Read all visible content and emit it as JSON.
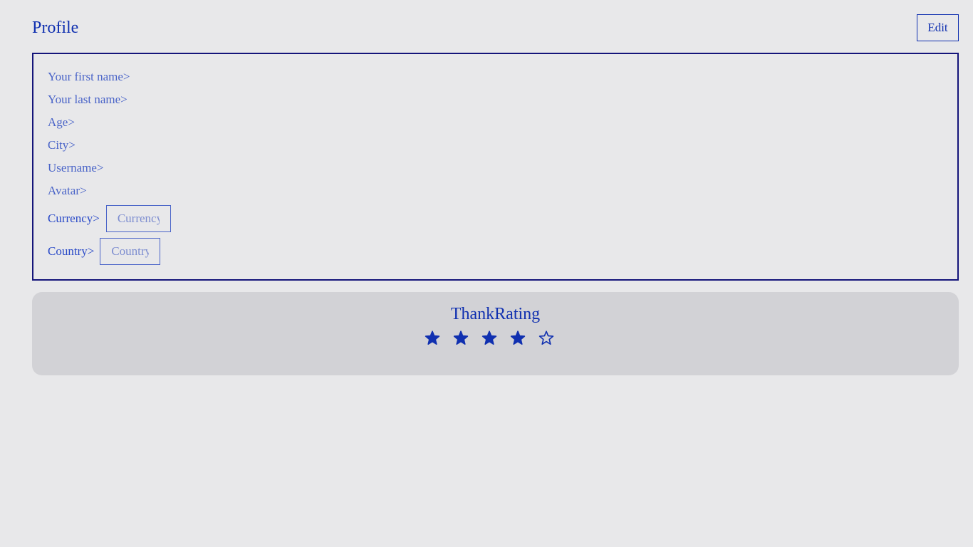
{
  "header": {
    "title": "Profile",
    "edit_label": "Edit"
  },
  "profile": {
    "fields": [
      {
        "label": "Your first name>"
      },
      {
        "label": "Your last name>"
      },
      {
        "label": "Age>"
      },
      {
        "label": "City>"
      },
      {
        "label": "Username>"
      },
      {
        "label": "Avatar>"
      }
    ],
    "currency": {
      "label": "Currency>",
      "placeholder": "Currency",
      "value": ""
    },
    "country": {
      "label": "Country>",
      "placeholder": "Country",
      "value": ""
    }
  },
  "rating": {
    "title": "ThankRating",
    "value": 4,
    "max": 5
  },
  "colors": {
    "accent": "#1030b0",
    "card_border": "#14147a",
    "field_text": "#4a64c8",
    "panel_bg": "#d2d2d6"
  }
}
